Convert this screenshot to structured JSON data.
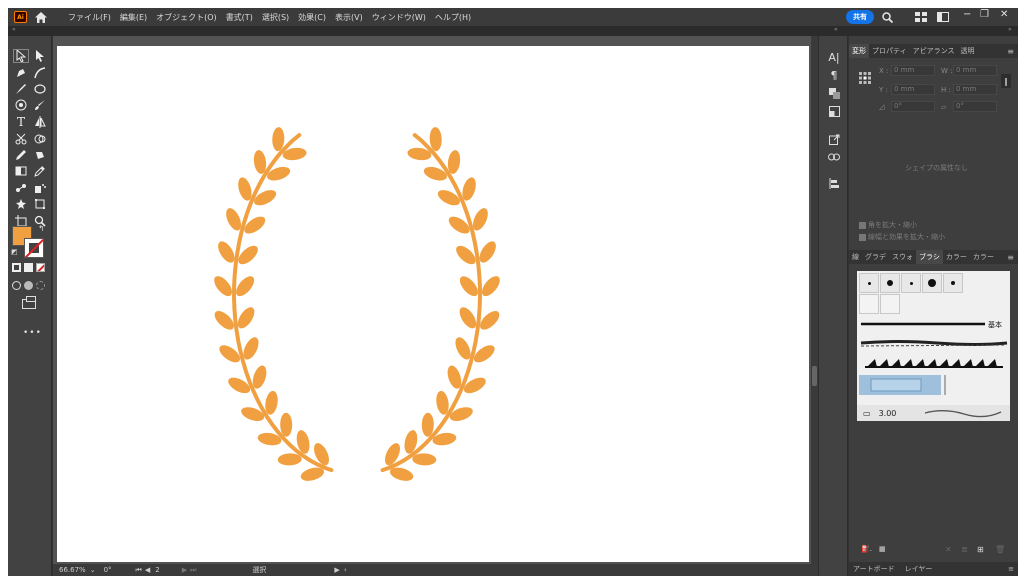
{
  "menubar": {
    "app_logo": "Ai",
    "items": [
      "ファイル(F)",
      "編集(E)",
      "オブジェクト(O)",
      "書式(T)",
      "選択(S)",
      "効果(C)",
      "表示(V)",
      "ウィンドウ(W)",
      "ヘルプ(H)"
    ],
    "share_label": "共有",
    "icons": [
      "home-icon",
      "search-icon",
      "arrange-documents-icon",
      "workspace-icon"
    ]
  },
  "toolbar": {
    "fill_color": "#f0a040",
    "stroke_color": "none",
    "more_label": "•••"
  },
  "canvas": {
    "artwork": "laurel-wreath",
    "artwork_color": "#f0a040"
  },
  "statusbar": {
    "zoom": "66.67%",
    "rotation": "0°",
    "artboard_number": "2",
    "tool_name": "選択"
  },
  "properties_panel": {
    "tabs": [
      "変形",
      "プロパティ",
      "アピアランス",
      "透明"
    ],
    "x_label": "X :",
    "x_value": "0 mm",
    "y_label": "Y :",
    "y_value": "0 mm",
    "w_label": "W :",
    "w_value": "0 mm",
    "h_label": "H :",
    "h_value": "0 mm",
    "angle_value": "0°",
    "shear_value": "0°",
    "no_shape_text": "シェイプの属性なし",
    "scale_corners_label": "角を拡大・縮小",
    "scale_strokes_label": "線幅と効果を拡大・縮小"
  },
  "brush_panel": {
    "tabs": [
      "線",
      "グラデ",
      "スウォ",
      "ブラシ",
      "カラー",
      "カラー"
    ],
    "basic_brush_label": "基本",
    "stroke_weight": "3.00"
  },
  "bottom_panel": {
    "tabs": [
      "アートボード",
      "レイヤー"
    ]
  }
}
